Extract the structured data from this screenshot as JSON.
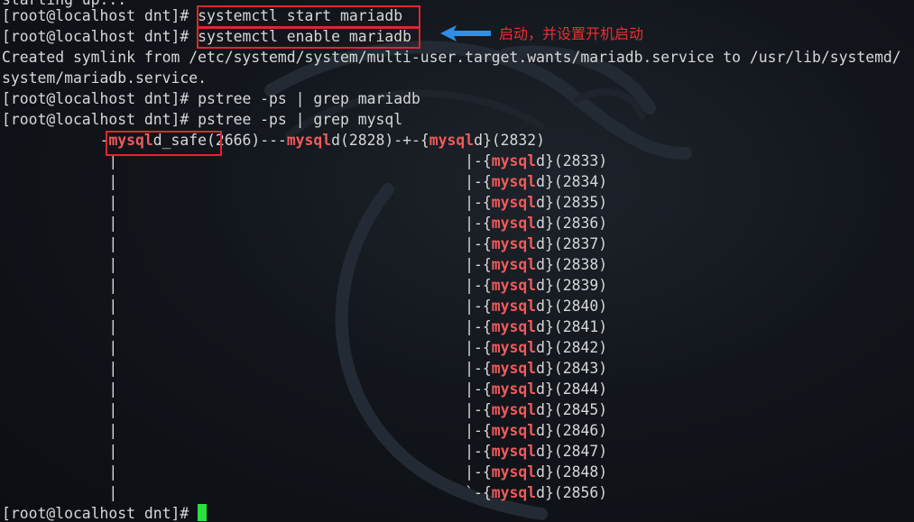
{
  "terminal": {
    "top_clipped": "starting up...",
    "prompt": "[root@localhost dnt]# ",
    "cmd_start": "systemctl start mariadb",
    "cmd_enable": "systemctl enable mariadb",
    "created_line1": "Created symlink from /etc/systemd/system/multi-user.target.wants/mariadb.service to /usr/lib/systemd/",
    "created_line2": "system/mariadb.service.",
    "cmd_pstree_mariadb": "pstree -ps | grep mariadb",
    "cmd_pstree_mysql": "pstree -ps | grep mysql"
  },
  "annotation": {
    "text": "启动，并设置开机启动",
    "color": "#ea2f2f",
    "arrow_color": "#2f8fe6"
  },
  "tree": {
    "indent": "           ",
    "root_dash": "-",
    "safe_match": "mysql",
    "safe_rest": "d_safe",
    "safe_pid": "(2666)---",
    "mysqld_match": "mysql",
    "mysqld_rest": "d",
    "mysqld_pid": "(2828)-+-",
    "child_match": "mysql",
    "child_rest": "d",
    "trunk": "|",
    "first_child_pid": "(2832)",
    "children": [
      {
        "branch": "|-",
        "pid": "(2833)"
      },
      {
        "branch": "|-",
        "pid": "(2834)"
      },
      {
        "branch": "|-",
        "pid": "(2835)"
      },
      {
        "branch": "|-",
        "pid": "(2836)"
      },
      {
        "branch": "|-",
        "pid": "(2837)"
      },
      {
        "branch": "|-",
        "pid": "(2838)"
      },
      {
        "branch": "|-",
        "pid": "(2839)"
      },
      {
        "branch": "|-",
        "pid": "(2840)"
      },
      {
        "branch": "|-",
        "pid": "(2841)"
      },
      {
        "branch": "|-",
        "pid": "(2842)"
      },
      {
        "branch": "|-",
        "pid": "(2843)"
      },
      {
        "branch": "|-",
        "pid": "(2844)"
      },
      {
        "branch": "|-",
        "pid": "(2845)"
      },
      {
        "branch": "|-",
        "pid": "(2846)"
      },
      {
        "branch": "|-",
        "pid": "(2847)"
      },
      {
        "branch": "|-",
        "pid": "(2848)"
      },
      {
        "branch": "`-",
        "pid": "(2856)"
      }
    ]
  },
  "colors": {
    "highlight": "#f05a5a",
    "box": "#e0262b",
    "cursor": "#27e23b",
    "text": "#d7d7d7"
  }
}
